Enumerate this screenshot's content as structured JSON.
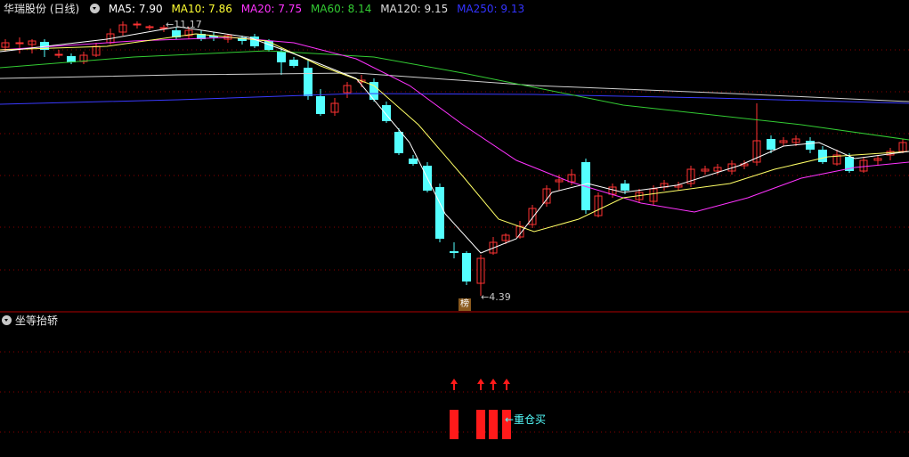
{
  "header": {
    "title": "华瑞股份 (日线)",
    "ma": [
      {
        "label": "MA5: 7.90",
        "color": "#ffffff"
      },
      {
        "label": "MA10: 7.86",
        "color": "#ffff33"
      },
      {
        "label": "MA20: 7.75",
        "color": "#ff33ff"
      },
      {
        "label": "MA60: 8.14",
        "color": "#33cc33"
      },
      {
        "label": "MA120: 9.15",
        "color": "#dddddd"
      },
      {
        "label": "MA250: 9.13",
        "color": "#3333ff"
      }
    ]
  },
  "annotations": {
    "high_label": "11.17",
    "low_label": "4.39",
    "badge": "榜"
  },
  "sub_panel": {
    "title": "坐等抬轿",
    "signal_label": "←重仓买"
  },
  "colors": {
    "up": "#ff3232",
    "down": "#54ffff",
    "grid": "#8a0000",
    "signal": "#ff1a1a"
  },
  "chart_data": {
    "type": "candlestick",
    "series_count": 68,
    "price_range": [
      4.2,
      11.6
    ],
    "high_marker": 11.17,
    "low_marker": 4.39,
    "ma_values": {
      "MA5": 7.9,
      "MA10": 7.86,
      "MA20": 7.75,
      "MA60": 8.14,
      "MA120": 9.15,
      "MA250": 9.13
    },
    "signal_indices": [
      34,
      36,
      37,
      38
    ]
  }
}
